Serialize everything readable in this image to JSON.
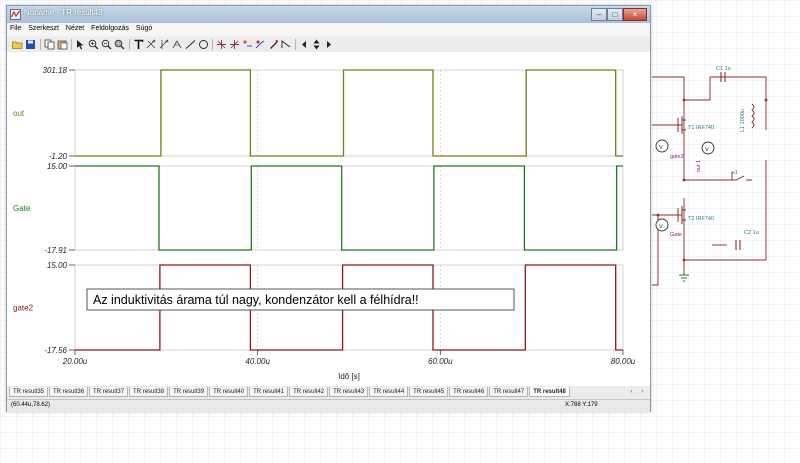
{
  "window": {
    "title": "Noname - TR result48",
    "controls": [
      "–",
      "□",
      "×"
    ]
  },
  "menubar": {
    "items": [
      "File",
      "Szerkeszt",
      "Nézet",
      "Feldolgozás",
      "Súgó"
    ]
  },
  "toolbar": {
    "icons": [
      "open-folder-icon",
      "save-disk-icon",
      "copy-icon",
      "paste-icon",
      "pointer-arrow-icon",
      "zoom-in-icon",
      "zoom-out-icon",
      "zoom-fit-icon",
      "text-tool-icon",
      "cursor-1-icon",
      "cursor-2-icon",
      "cursor-diff-icon",
      "line-tool-icon",
      "circle-tool-icon",
      "marker-1-icon",
      "marker-2-icon",
      "marker-3-icon",
      "marker-4-icon",
      "pen-icon",
      "polyline-icon",
      "left-arrow-icon",
      "up-down-arrow-icon",
      "right-arrow-icon"
    ]
  },
  "chart_data": [
    {
      "type": "line",
      "series": [
        {
          "name": "out",
          "color": "#7a7a16",
          "points": [
            [
              20,
              -1.2
            ],
            [
              27,
              -1.2
            ],
            [
              29.4,
              -1.2
            ],
            [
              29.4,
              301.18
            ],
            [
              39.2,
              301.18
            ],
            [
              39.2,
              -1.2
            ],
            [
              49.4,
              -1.2
            ],
            [
              49.4,
              301.18
            ],
            [
              59.2,
              301.18
            ],
            [
              59.2,
              -1.2
            ],
            [
              69.4,
              -1.2
            ],
            [
              69.4,
              301.18
            ],
            [
              79.2,
              301.18
            ],
            [
              79.2,
              -1.2
            ],
            [
              80,
              -1.2
            ]
          ]
        }
      ],
      "ylabel": "out",
      "ylim": [
        -1.2,
        301.18
      ],
      "y_tick_labels": [
        "301.18",
        "-1.20"
      ],
      "xlim": [
        20,
        80
      ],
      "grid": true
    },
    {
      "type": "line",
      "series": [
        {
          "name": "Gate",
          "color": "#1e7a1e",
          "points": [
            [
              20,
              15
            ],
            [
              29.2,
              15
            ],
            [
              29.2,
              -17.91
            ],
            [
              39.3,
              -17.91
            ],
            [
              39.3,
              15
            ],
            [
              49.2,
              15
            ],
            [
              49.2,
              -17.91
            ],
            [
              59.3,
              -17.91
            ],
            [
              59.3,
              15
            ],
            [
              69.2,
              15
            ],
            [
              69.2,
              -17.91
            ],
            [
              79.3,
              -17.91
            ],
            [
              79.3,
              15
            ],
            [
              80,
              15
            ]
          ]
        }
      ],
      "ylabel": "Gate",
      "ylim": [
        -17.91,
        15.0
      ],
      "y_tick_labels": [
        "15.00",
        "-17.91"
      ],
      "xlim": [
        20,
        80
      ],
      "grid": true
    },
    {
      "type": "line",
      "series": [
        {
          "name": "gate2",
          "color": "#8b1a1a",
          "points": [
            [
              20,
              -17.56
            ],
            [
              29.3,
              -17.56
            ],
            [
              29.3,
              15
            ],
            [
              39.2,
              15
            ],
            [
              39.2,
              -17.56
            ],
            [
              49.3,
              -17.56
            ],
            [
              49.3,
              15
            ],
            [
              59.2,
              15
            ],
            [
              59.2,
              -17.56
            ],
            [
              69.3,
              -17.56
            ],
            [
              69.3,
              15
            ],
            [
              79.2,
              15
            ],
            [
              79.2,
              -17.56
            ],
            [
              80,
              -17.56
            ]
          ]
        }
      ],
      "ylabel": "gate2",
      "ylim": [
        -17.56,
        15.0
      ],
      "y_tick_labels": [
        "15.00",
        "-17.56"
      ],
      "xlim": [
        20,
        80
      ],
      "x_tick_labels": [
        "20.00u",
        "40.00u",
        "60.00u",
        "80.00u"
      ],
      "xlabel": "Idő [s]",
      "grid": true
    }
  ],
  "annotation": {
    "text": "Az induktivitás árama túl nagy, kondenzátor kell a félhídra!!"
  },
  "tabs": [
    "TR result35",
    "TR result36",
    "TR result37",
    "TR result38",
    "TR result39",
    "TR result40",
    "TR result41",
    "TR result42",
    "TR result43",
    "TR result44",
    "TR result45",
    "TR result46",
    "TR result47",
    "TR result48"
  ],
  "active_tab": "TR result48",
  "status": {
    "left": "(60.44u,78.62)",
    "right": "X:788  Y:179"
  },
  "schematic": {
    "labels": {
      "c1": "C1 1u",
      "t1": "T1 IRF740",
      "l1": "L1 1000u",
      "gate2": "gate2",
      "out1": "out 1",
      "s1": "s1",
      "t2": "T2 IRF740",
      "gate": "Gate",
      "c2": "C2 1u",
      "v": "V"
    }
  },
  "colors": {
    "out": "#7a7a16",
    "gate": "#1e7a1e",
    "gate2": "#8b1a1a",
    "schematic_wire": "#8b2a2a",
    "schematic_label": "#2a7a8a"
  }
}
